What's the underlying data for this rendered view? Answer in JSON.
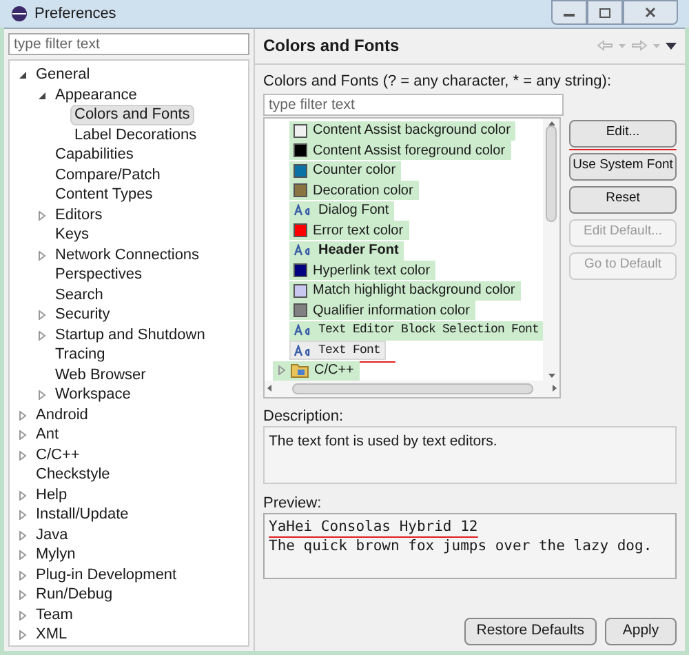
{
  "window": {
    "title": "Preferences"
  },
  "sidebar": {
    "filter": {
      "placeholder": "type filter text"
    },
    "items": [
      {
        "label": "General",
        "expanded": true,
        "selected": false,
        "children": [
          {
            "label": "Appearance",
            "expanded": true,
            "selected": false,
            "children": [
              {
                "label": "Colors and Fonts",
                "selected": true
              },
              {
                "label": "Label Decorations",
                "selected": false
              }
            ]
          },
          {
            "label": "Capabilities",
            "selected": false
          },
          {
            "label": "Compare/Patch",
            "selected": false
          },
          {
            "label": "Content Types",
            "selected": false
          },
          {
            "label": "Editors",
            "expanded": false,
            "selected": false
          },
          {
            "label": "Keys",
            "selected": false
          },
          {
            "label": "Network Connections",
            "expanded": false,
            "selected": false
          },
          {
            "label": "Perspectives",
            "selected": false
          },
          {
            "label": "Search",
            "selected": false
          },
          {
            "label": "Security",
            "expanded": false,
            "selected": false
          },
          {
            "label": "Startup and Shutdown",
            "expanded": false,
            "selected": false
          },
          {
            "label": "Tracing",
            "selected": false
          },
          {
            "label": "Web Browser",
            "selected": false
          },
          {
            "label": "Workspace",
            "expanded": false,
            "selected": false
          }
        ]
      },
      {
        "label": "Android",
        "expanded": false,
        "selected": false
      },
      {
        "label": "Ant",
        "expanded": false,
        "selected": false
      },
      {
        "label": "C/C++",
        "expanded": false,
        "selected": false
      },
      {
        "label": "Checkstyle",
        "selected": false
      },
      {
        "label": "Help",
        "expanded": false,
        "selected": false
      },
      {
        "label": "Install/Update",
        "expanded": false,
        "selected": false
      },
      {
        "label": "Java",
        "expanded": false,
        "selected": false
      },
      {
        "label": "Mylyn",
        "expanded": false,
        "selected": false
      },
      {
        "label": "Plug-in Development",
        "expanded": false,
        "selected": false
      },
      {
        "label": "Run/Debug",
        "expanded": false,
        "selected": false
      },
      {
        "label": "Team",
        "expanded": false,
        "selected": false
      },
      {
        "label": "XML",
        "expanded": false,
        "selected": false
      }
    ]
  },
  "page": {
    "title": "Colors and Fonts",
    "filter_label": "Colors and Fonts (? = any character, * = any string):",
    "filter": {
      "placeholder": "type filter text"
    },
    "items": [
      {
        "kind": "color",
        "label": "Content Assist background color",
        "color": "#f0f0f0",
        "selected": false,
        "underlined": false
      },
      {
        "kind": "color",
        "label": "Content Assist foreground color",
        "color": "#000000",
        "selected": false,
        "underlined": false
      },
      {
        "kind": "color",
        "label": "Counter color",
        "color": "#0b72a6",
        "selected": false,
        "underlined": false
      },
      {
        "kind": "color",
        "label": "Decoration color",
        "color": "#8a7442",
        "selected": false,
        "underlined": false
      },
      {
        "kind": "font",
        "label": "Dialog Font",
        "selected": false,
        "underlined": false
      },
      {
        "kind": "color",
        "label": "Error text color",
        "color": "#ff0000",
        "selected": false,
        "underlined": false
      },
      {
        "kind": "bold_font",
        "label": "Header Font",
        "selected": false,
        "underlined": false
      },
      {
        "kind": "color",
        "label": "Hyperlink text color",
        "color": "#000080",
        "selected": false,
        "underlined": false
      },
      {
        "kind": "color",
        "label": "Match highlight background color",
        "color": "#c8c8f0",
        "selected": false,
        "underlined": false
      },
      {
        "kind": "color",
        "label": "Qualifier information color",
        "color": "#808080",
        "selected": false,
        "underlined": false
      },
      {
        "kind": "mono_font",
        "label": "Text Editor Block Selection Font",
        "selected": false,
        "underlined": false
      },
      {
        "kind": "mono_font",
        "label": "Text Font",
        "selected": true,
        "underlined": true
      },
      {
        "kind": "category",
        "label": "C/C++",
        "expanded": false,
        "selected": false,
        "underlined": false
      }
    ],
    "buttons": [
      {
        "label": "Edit...",
        "disabled": false,
        "underlined": true
      },
      {
        "label": "Use System Font",
        "disabled": false
      },
      {
        "label": "Reset",
        "disabled": false
      },
      {
        "label": "Edit Default...",
        "disabled": true
      },
      {
        "label": "Go to Default",
        "disabled": true
      }
    ],
    "description_label": "Description:",
    "description": "The text font is used by text editors.",
    "preview_label": "Preview:",
    "preview": [
      {
        "text": "YaHei Consolas Hybrid 12",
        "underlined": true
      },
      {
        "text": "The quick brown fox jumps over the lazy dog.",
        "underlined": false
      }
    ]
  },
  "footer": {
    "buttons": [
      "Restore Defaults",
      "Apply"
    ]
  }
}
